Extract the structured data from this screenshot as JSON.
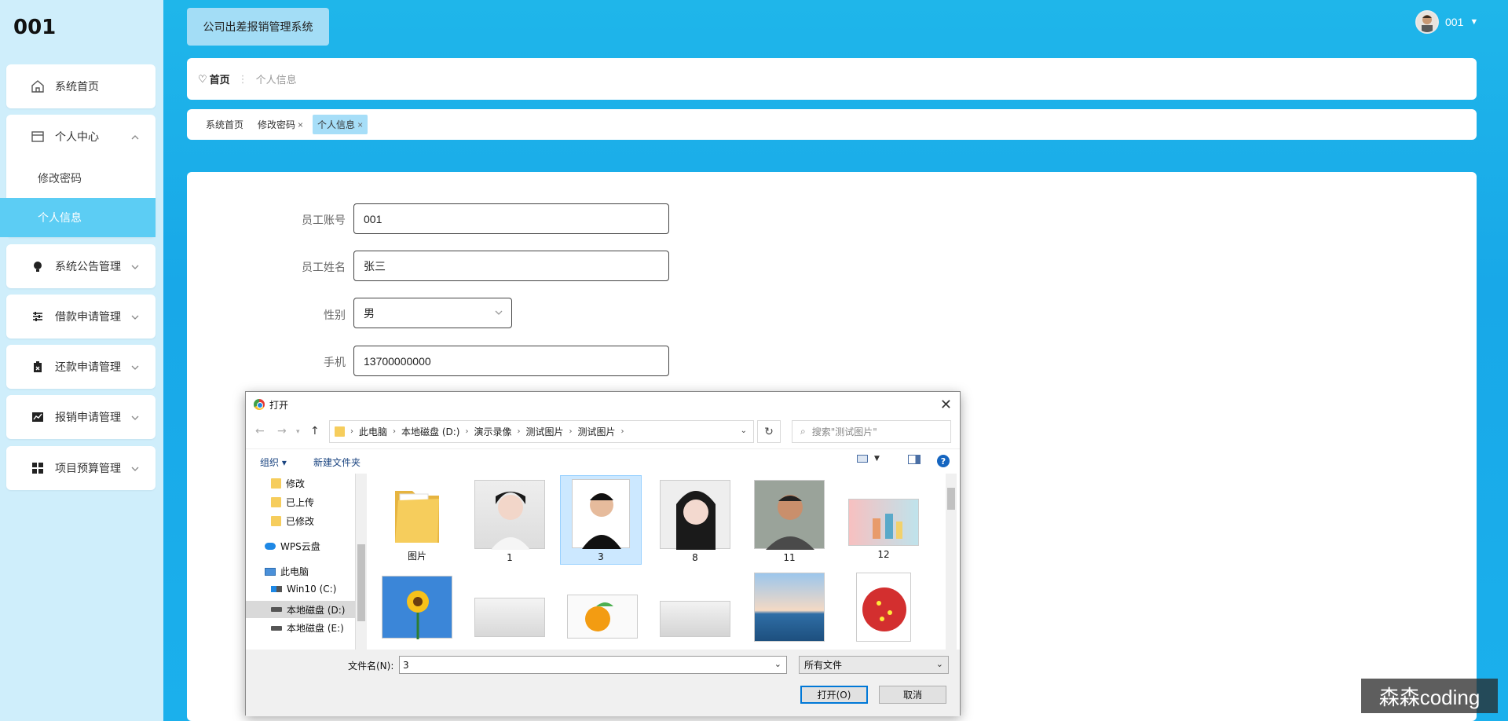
{
  "sidebar": {
    "brand": "001",
    "items": [
      {
        "label": "系统首页",
        "icon": "home-icon"
      },
      {
        "label": "个人中心",
        "icon": "calendar-icon",
        "expanded": true,
        "children": [
          {
            "label": "修改密码"
          },
          {
            "label": "个人信息",
            "active": true
          }
        ]
      },
      {
        "label": "系统公告管理",
        "icon": "bulb-icon"
      },
      {
        "label": "借款申请管理",
        "icon": "sliders-icon"
      },
      {
        "label": "还款申请管理",
        "icon": "clipboard-icon"
      },
      {
        "label": "报销申请管理",
        "icon": "chart-icon"
      },
      {
        "label": "项目预算管理",
        "icon": "grid-icon"
      }
    ]
  },
  "header": {
    "app_title": "公司出差报销管理系统",
    "user": "001"
  },
  "breadcrumb": {
    "home": "首页",
    "current": "个人信息"
  },
  "tabs": [
    {
      "label": "系统首页"
    },
    {
      "label": "修改密码",
      "closable": true
    },
    {
      "label": "个人信息",
      "closable": true,
      "active": true
    }
  ],
  "form": {
    "account": {
      "label": "员工账号",
      "value": "001"
    },
    "name": {
      "label": "员工姓名",
      "value": "张三"
    },
    "gender": {
      "label": "性别",
      "value": "男"
    },
    "phone": {
      "label": "手机",
      "value": "13700000000"
    }
  },
  "dialog": {
    "title": "打开",
    "path": [
      "此电脑",
      "本地磁盘 (D:)",
      "演示录像",
      "测试图片",
      "测试图片"
    ],
    "search_placeholder": "搜索\"测试图片\"",
    "organize": "组织 ▾",
    "new_folder": "新建文件夹",
    "tree": [
      {
        "label": "修改",
        "icon": "folder-icon"
      },
      {
        "label": "已上传",
        "icon": "folder-icon"
      },
      {
        "label": "已修改",
        "icon": "folder-icon"
      },
      {
        "label": "WPS云盘",
        "icon": "cloud-icon"
      },
      {
        "label": "此电脑",
        "icon": "pc-icon"
      },
      {
        "label": "Win10 (C:)",
        "icon": "disk-icon"
      },
      {
        "label": "本地磁盘 (D:)",
        "icon": "disk-icon",
        "selected": true
      },
      {
        "label": "本地磁盘 (E:)",
        "icon": "disk-icon"
      }
    ],
    "files_row1": [
      {
        "label": "图片",
        "kind": "folder"
      },
      {
        "label": "1"
      },
      {
        "label": "3",
        "selected": true
      },
      {
        "label": "8"
      },
      {
        "label": "11"
      },
      {
        "label": "12"
      }
    ],
    "filename_label": "文件名(N):",
    "filename_value": "3",
    "filetype": "所有文件",
    "open_label": "打开(O)",
    "cancel_label": "取消"
  },
  "watermark": "森森coding"
}
